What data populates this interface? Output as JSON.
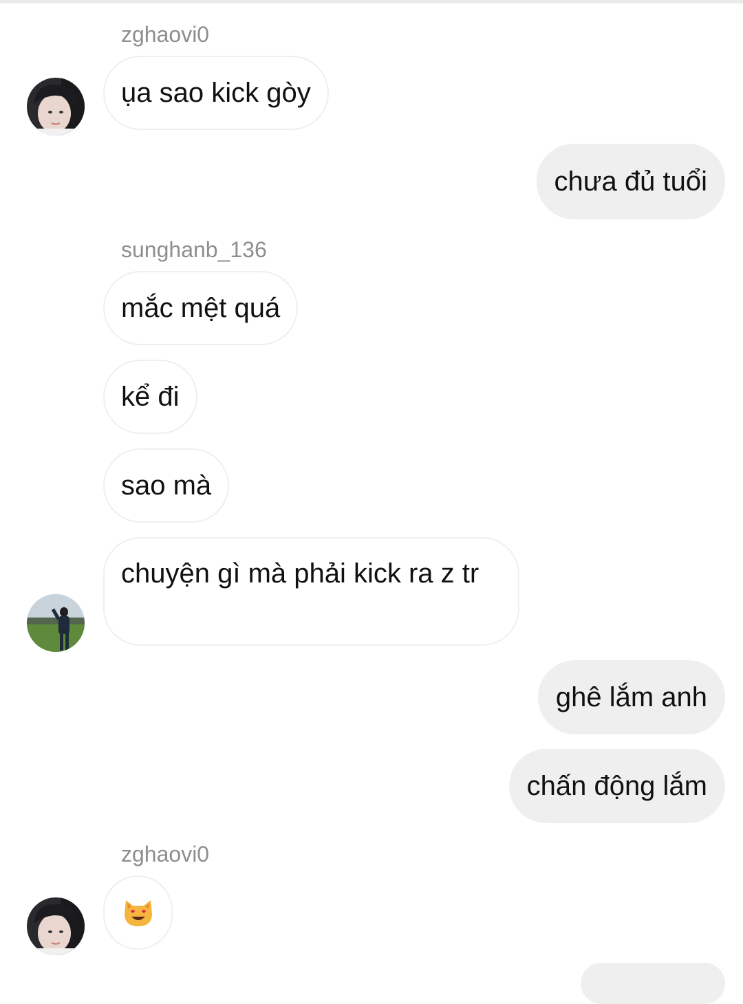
{
  "messages": [
    {
      "sender": "zghaovi0",
      "text": "ụa sao kick gòy"
    },
    {
      "text": "chưa đủ tuổi"
    },
    {
      "sender": "sunghanb_136",
      "text": "mắc mệt quá"
    },
    {
      "text": "kể đi"
    },
    {
      "text": "sao mà"
    },
    {
      "text": "chuyện gì mà phải kick ra z tr"
    },
    {
      "text": "ghê lắm anh"
    },
    {
      "text": "chấn động lắm"
    },
    {
      "sender": "zghaovi0",
      "emoji": "heart-eyes-cat-emoji"
    }
  ],
  "avatars": {
    "zghaovi0": "avatar-portrait",
    "sunghanb_136": "avatar-field-photo"
  }
}
